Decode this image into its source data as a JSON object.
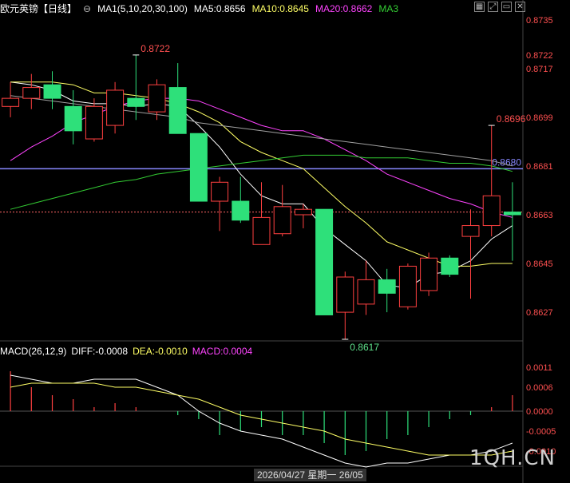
{
  "header": {
    "symbol": "欧元英镑",
    "period": "【日线】",
    "ma_label": "MA1(5,10,20,30,100)",
    "ma5": "MA5:0.8656",
    "ma10": "MA10:0.8645",
    "ma20": "MA20:0.8662",
    "ma30": "MA3",
    "tool_icons": [
      "grid-icon",
      "expand-icon",
      "minimize-icon",
      "close-icon"
    ]
  },
  "macd_header": {
    "label": "MACD(26,12,9)",
    "diff": "DIFF:-0.0008",
    "dea": "DEA:-0.0010",
    "macd": "MACD:0.0004"
  },
  "watermark": "1QH.CN",
  "date_box": "2026/04/27 星期一 26/05",
  "colors": {
    "up": "#ff4040",
    "down": "#2ee07a",
    "ma5": "#ffffff",
    "ma10": "#ffff66",
    "ma20": "#ff44ff",
    "ma30": "#33cc33",
    "ma100": "#a0a0a0",
    "hline": "#8888ff"
  },
  "chart_data": [
    {
      "type": "candlestick",
      "title": "欧元英镑 日线",
      "ylim": [
        0.8617,
        0.8737
      ],
      "y_ticks": [
        "0.8735",
        "0.8722",
        "0.8717",
        "0.8699",
        "0.8681",
        "0.8663",
        "0.8645",
        "0.8627"
      ],
      "current_price": 0.8664,
      "horizontal_line": {
        "value": 0.868,
        "label": "0.8680"
      },
      "annotations": [
        {
          "label": "0.8722",
          "index": 6,
          "value": 0.8722
        },
        {
          "label": "0.8696",
          "index": 23,
          "value": 0.8696
        },
        {
          "label": "0.8617",
          "index": 16,
          "value": 0.8617
        }
      ],
      "candles": [
        {
          "o": 0.8703,
          "h": 0.8712,
          "l": 0.8699,
          "c": 0.8706
        },
        {
          "o": 0.8706,
          "h": 0.8715,
          "l": 0.8702,
          "c": 0.871
        },
        {
          "o": 0.8711,
          "h": 0.8716,
          "l": 0.8702,
          "c": 0.8706
        },
        {
          "o": 0.8703,
          "h": 0.8709,
          "l": 0.8689,
          "c": 0.8694
        },
        {
          "o": 0.8691,
          "h": 0.8706,
          "l": 0.869,
          "c": 0.8703
        },
        {
          "o": 0.8696,
          "h": 0.8712,
          "l": 0.8693,
          "c": 0.8709
        },
        {
          "o": 0.8706,
          "h": 0.8722,
          "l": 0.8698,
          "c": 0.8703
        },
        {
          "o": 0.8701,
          "h": 0.8713,
          "l": 0.8698,
          "c": 0.8711
        },
        {
          "o": 0.871,
          "h": 0.8719,
          "l": 0.8693,
          "c": 0.8693
        },
        {
          "o": 0.8693,
          "h": 0.8693,
          "l": 0.8668,
          "c": 0.8668
        },
        {
          "o": 0.8668,
          "h": 0.8677,
          "l": 0.8657,
          "c": 0.8675
        },
        {
          "o": 0.8668,
          "h": 0.8677,
          "l": 0.866,
          "c": 0.8661
        },
        {
          "o": 0.8652,
          "h": 0.8675,
          "l": 0.8652,
          "c": 0.8662
        },
        {
          "o": 0.8656,
          "h": 0.8674,
          "l": 0.8655,
          "c": 0.8666
        },
        {
          "o": 0.8663,
          "h": 0.8667,
          "l": 0.8658,
          "c": 0.8665
        },
        {
          "o": 0.8665,
          "h": 0.8665,
          "l": 0.8626,
          "c": 0.8626
        },
        {
          "o": 0.8627,
          "h": 0.8642,
          "l": 0.8617,
          "c": 0.864
        },
        {
          "o": 0.863,
          "h": 0.8646,
          "l": 0.8626,
          "c": 0.8639
        },
        {
          "o": 0.8639,
          "h": 0.8643,
          "l": 0.8627,
          "c": 0.8634
        },
        {
          "o": 0.8629,
          "h": 0.8645,
          "l": 0.8628,
          "c": 0.8644
        },
        {
          "o": 0.8635,
          "h": 0.8649,
          "l": 0.8633,
          "c": 0.8647
        },
        {
          "o": 0.8647,
          "h": 0.8648,
          "l": 0.864,
          "c": 0.8641
        },
        {
          "o": 0.8655,
          "h": 0.8665,
          "l": 0.8632,
          "c": 0.8659
        },
        {
          "o": 0.8659,
          "h": 0.8696,
          "l": 0.8655,
          "c": 0.867
        },
        {
          "o": 0.8664,
          "h": 0.8675,
          "l": 0.8646,
          "c": 0.8663
        }
      ],
      "series": [
        {
          "name": "MA5",
          "values": [
            0.8712,
            0.8711,
            0.8709,
            0.8705,
            0.8704,
            0.8704,
            0.8703,
            0.8704,
            0.8703,
            0.8696,
            0.8688,
            0.8678,
            0.867,
            0.8667,
            0.8667,
            0.8658,
            0.8652,
            0.8646,
            0.8637,
            0.8636,
            0.8641,
            0.8642,
            0.8646,
            0.8654,
            0.8659
          ]
        },
        {
          "name": "MA10",
          "values": [
            0.8712,
            0.8712,
            0.8712,
            0.8711,
            0.8708,
            0.8708,
            0.8707,
            0.8706,
            0.8704,
            0.8701,
            0.8697,
            0.869,
            0.8686,
            0.8683,
            0.868,
            0.8673,
            0.8666,
            0.866,
            0.8653,
            0.865,
            0.8647,
            0.8644,
            0.8644,
            0.8645,
            0.8645
          ]
        },
        {
          "name": "MA20",
          "values": [
            0.8683,
            0.8688,
            0.8692,
            0.8697,
            0.87,
            0.8703,
            0.8705,
            0.8706,
            0.8706,
            0.8705,
            0.8702,
            0.8699,
            0.8696,
            0.8694,
            0.8694,
            0.8691,
            0.8687,
            0.8683,
            0.8678,
            0.8675,
            0.8672,
            0.8669,
            0.8667,
            0.8664,
            0.8662
          ]
        },
        {
          "name": "MA30",
          "values": [
            0.8665,
            0.8667,
            0.8669,
            0.8671,
            0.8673,
            0.8675,
            0.8676,
            0.8678,
            0.8679,
            0.868,
            0.8681,
            0.8682,
            0.8683,
            0.8684,
            0.8685,
            0.8685,
            0.8685,
            0.8684,
            0.8684,
            0.8684,
            0.8683,
            0.8682,
            0.8682,
            0.8681,
            0.8679
          ]
        },
        {
          "name": "MA100",
          "values": [
            0.8707,
            0.8706,
            0.8705,
            0.8704,
            0.8703,
            0.8702,
            0.8701,
            0.87,
            0.8699,
            0.8697,
            0.8696,
            0.8695,
            0.8694,
            0.8693,
            0.8692,
            0.8691,
            0.869,
            0.8689,
            0.8688,
            0.8687,
            0.8686,
            0.8685,
            0.8684,
            0.8683,
            0.8681
          ]
        }
      ]
    },
    {
      "type": "macd",
      "title": "MACD(26,12,9)",
      "ylim": [
        -0.0013,
        0.0013
      ],
      "y_ticks": [
        "0.0011",
        "0.0006",
        "0.0000",
        "-0.0005",
        "-0.0010"
      ],
      "histogram": [
        0.001,
        0.0006,
        0.0004,
        0.0003,
        0.0001,
        0.0002,
        0.0001,
        0.0,
        -0.0001,
        -0.0002,
        -0.0006,
        -0.0005,
        -0.0004,
        -0.0006,
        -0.0006,
        -0.0008,
        -0.0011,
        -0.001,
        -0.0007,
        -0.0006,
        -0.0004,
        -0.0002,
        -0.0001,
        0.0001,
        0.0004
      ],
      "series": [
        {
          "name": "DIFF",
          "values": [
            0.0009,
            0.0008,
            0.0007,
            0.0007,
            0.0008,
            0.0008,
            0.0008,
            0.0006,
            0.0004,
            0.0,
            -0.0003,
            -0.0005,
            -0.0006,
            -0.0007,
            -0.0009,
            -0.0011,
            -0.0013,
            -0.0014,
            -0.0013,
            -0.0013,
            -0.0012,
            -0.0011,
            -0.0011,
            -0.001,
            -0.0008
          ]
        },
        {
          "name": "DEA",
          "values": [
            0.0006,
            0.0007,
            0.0007,
            0.0007,
            0.0007,
            0.0006,
            0.0006,
            0.0005,
            0.0004,
            0.0003,
            0.0001,
            -0.0001,
            -0.0002,
            -0.0003,
            -0.0004,
            -0.0005,
            -0.0007,
            -0.0008,
            -0.0009,
            -0.001,
            -0.0011,
            -0.0011,
            -0.0011,
            -0.0011,
            -0.001
          ]
        }
      ]
    }
  ]
}
